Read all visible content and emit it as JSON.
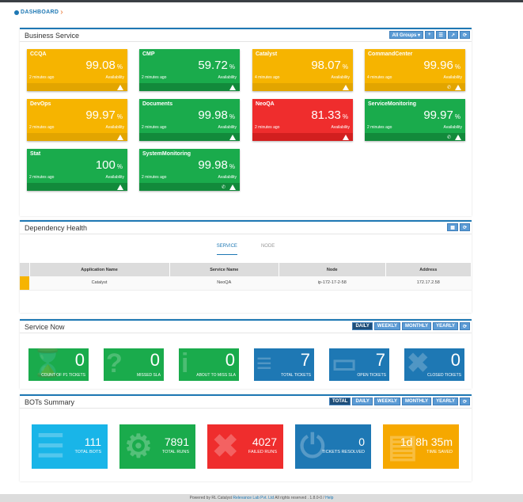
{
  "brand": {
    "label": "DASHBOARD"
  },
  "business": {
    "title": "Business Service",
    "all_groups": "All Groups ▾",
    "tiles": [
      {
        "name": "CCQA",
        "value": "99.08",
        "time": "2 minutes ago",
        "avail": "Availability",
        "color": "yellow"
      },
      {
        "name": "CMP",
        "value": "59.72",
        "time": "2 minutes ago",
        "avail": "Availability",
        "color": "green"
      },
      {
        "name": "Catalyst",
        "value": "98.07",
        "time": "4 minutes ago",
        "avail": "Availability",
        "color": "yellow"
      },
      {
        "name": "CommandCenter",
        "value": "99.96",
        "time": "4 minutes ago",
        "avail": "Availability",
        "color": "yellow"
      },
      {
        "name": "DevOps",
        "value": "99.97",
        "time": "2 minutes ago",
        "avail": "Availability",
        "color": "yellow"
      },
      {
        "name": "Documents",
        "value": "99.98",
        "time": "2 minutes ago",
        "avail": "Availability",
        "color": "green"
      },
      {
        "name": "NeoQA",
        "value": "81.33",
        "time": "2 minutes ago",
        "avail": "Availability",
        "color": "red"
      },
      {
        "name": "ServiceMonitoring",
        "value": "99.97",
        "time": "2 minutes ago",
        "avail": "Availability",
        "color": "green"
      },
      {
        "name": "Stat",
        "value": "100",
        "time": "2 minutes ago",
        "avail": "Availability",
        "color": "green"
      },
      {
        "name": "SystemMonitoring",
        "value": "99.98",
        "time": "2 minutes ago",
        "avail": "Availability",
        "color": "green"
      }
    ],
    "pct": "%"
  },
  "dependency": {
    "title": "Dependency Health",
    "tabs": [
      "SERVICE",
      "NODE"
    ],
    "columns": [
      "Application Name",
      "Service Name",
      "Node",
      "Address"
    ],
    "rows": [
      [
        "Catalyst",
        "NeoQA",
        "ip-172-17-2-58",
        "172.17.2.58"
      ]
    ]
  },
  "servicenow": {
    "title": "Service Now",
    "filters": [
      "DAILY",
      "WEEKLY",
      "MONTHLY",
      "YEARLY"
    ],
    "cards": [
      {
        "num": "0",
        "label": "COUNT OF P1 TICKETS",
        "color": "#1aab4c"
      },
      {
        "num": "0",
        "label": "MISSED SLA",
        "color": "#1aab4c"
      },
      {
        "num": "0",
        "label": "ABOUT TO MISS SLA",
        "color": "#1aab4c"
      },
      {
        "num": "7",
        "label": "TOTAL TICKETS",
        "color": "#1e78b4"
      },
      {
        "num": "7",
        "label": "OPEN TICKETS",
        "color": "#1e78b4"
      },
      {
        "num": "0",
        "label": "CLOSED TICKETS",
        "color": "#1e78b4"
      }
    ]
  },
  "bots": {
    "title": "BOTs Summary",
    "filters": [
      "TOTAL",
      "DAILY",
      "WEEKLY",
      "MONTHLY",
      "YEARLY"
    ],
    "cards": [
      {
        "num": "111",
        "label": "TOTAL BOTS",
        "color": "#19b5e8"
      },
      {
        "num": "7891",
        "label": "TOTAL RUNS",
        "color": "#1aab4c"
      },
      {
        "num": "4027",
        "label": "FAILED RUNS",
        "color": "#ef2d2d"
      },
      {
        "num": "0",
        "label": "TICKETS RESOLVED",
        "color": "#1e78b4"
      },
      {
        "num": "1d 8h 35m",
        "label": "TIME SAVED",
        "color": "#f6a800"
      }
    ]
  },
  "footer": {
    "prefix": "Powered by RL Catalyst ",
    "link1": "Relevance Lab Pvt. Ltd",
    "mid": " All rights reserved . 1.8.0-0 / ",
    "link2": "Help"
  }
}
